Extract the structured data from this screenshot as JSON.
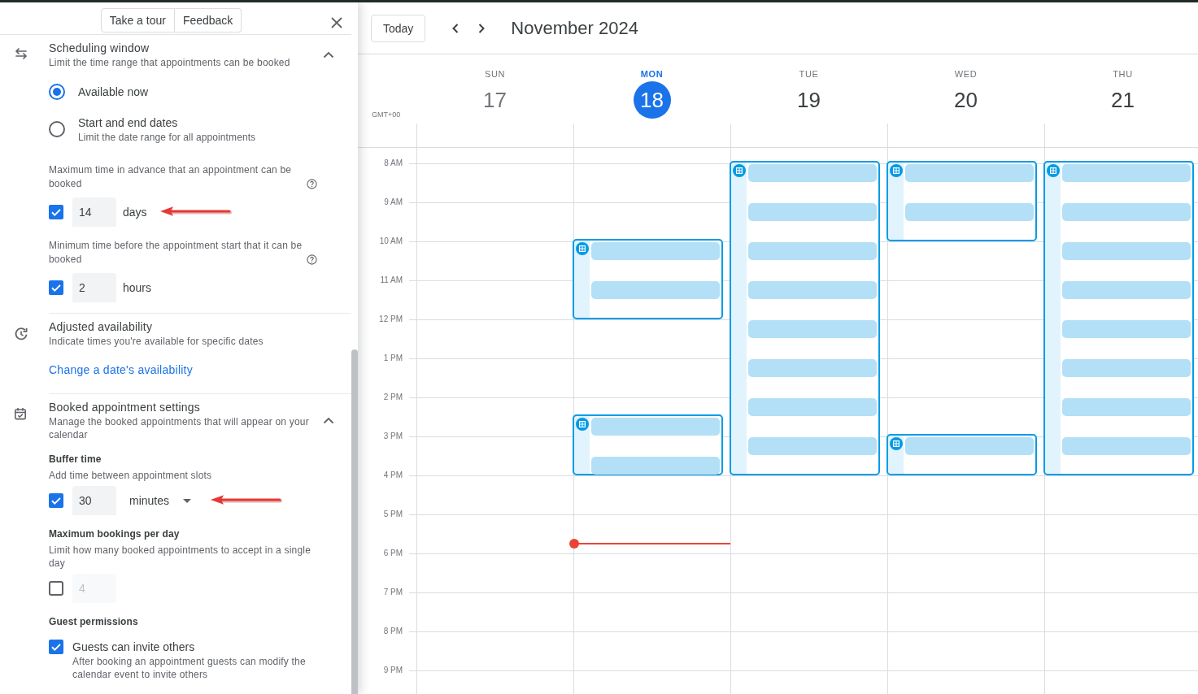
{
  "side_panel": {
    "header_buttons": [
      "Take a tour",
      "Feedback"
    ],
    "sections": [
      {
        "kind": "scheduling_window",
        "title": "Scheduling window",
        "subtitle": "Limit the time range that appointments can be booked",
        "expanded": true,
        "items": [
          {
            "kind": "radio",
            "label": "Available now",
            "selected": true
          },
          {
            "kind": "radio",
            "label": "Start and end dates",
            "description": "Limit the date range for all appointments",
            "selected": false
          },
          {
            "kind": "number",
            "label": "Maximum time in advance that an appointment can be booked",
            "help": true,
            "checked": true,
            "value": "14",
            "unit": "days",
            "unit_dropdown": false,
            "annotation_arrow": true
          },
          {
            "kind": "number",
            "label": "Minimum time before the appointment start that it can be booked",
            "help": true,
            "checked": true,
            "value": "2",
            "unit": "hours",
            "unit_dropdown": false,
            "annotation_arrow": false
          }
        ]
      },
      {
        "kind": "adjusted_availability",
        "title": "Adjusted availability",
        "subtitle": "Indicate times you're available for specific dates",
        "items": [
          {
            "kind": "link",
            "label": "Change a date's availability"
          }
        ]
      },
      {
        "kind": "booked_settings",
        "title": "Booked appointment settings",
        "subtitle": "Manage the booked appointments that will appear on your calendar",
        "expanded": true,
        "items": [
          {
            "kind": "number",
            "label": "Buffer time",
            "description": "Add time between appointment slots",
            "help": false,
            "checked": true,
            "value": "30",
            "unit": "minutes",
            "unit_dropdown": true,
            "annotation_arrow": true
          },
          {
            "kind": "number",
            "label": "Maximum bookings per day",
            "description": "Limit how many booked appointments to accept in a single day",
            "help": false,
            "checked": false,
            "value": "4",
            "annotation_arrow": false
          },
          {
            "kind": "checkbox",
            "label": "Guest permissions",
            "option": "Guests can invite others",
            "description": "After booking an appointment guests can modify the calendar event to invite others",
            "checked": true
          }
        ]
      }
    ]
  },
  "calendar": {
    "today_button": "Today",
    "title": "November 2024",
    "timezone": "GMT+00",
    "days": [
      {
        "name": "SUN",
        "date": "17",
        "today": false,
        "past": true
      },
      {
        "name": "MON",
        "date": "18",
        "today": true,
        "past": false,
        "half_hours": [
          {
            "kind": "free"
          },
          {
            "kind": "free"
          },
          {
            "kind": "free"
          },
          {
            "kind": "free"
          },
          {
            "kind": "slot"
          },
          {
            "kind": "buffer"
          },
          {
            "kind": "slot"
          },
          {
            "kind": "buffer"
          },
          {
            "kind": "free"
          },
          {
            "kind": "free"
          },
          {
            "kind": "free"
          },
          {
            "kind": "free"
          },
          {
            "kind": "free"
          },
          {
            "kind": "slot"
          },
          {
            "kind": "buffer"
          },
          {
            "kind": "slot"
          },
          {
            "kind": "free"
          },
          {
            "kind": "free"
          },
          {
            "kind": "free"
          },
          {
            "kind": "now"
          }
        ]
      },
      {
        "name": "TUE",
        "date": "19",
        "today": false,
        "past": false,
        "half_hours": [
          {
            "kind": "slot"
          },
          {
            "kind": "buffer"
          },
          {
            "kind": "slot"
          },
          {
            "kind": "buffer"
          },
          {
            "kind": "slot"
          },
          {
            "kind": "buffer"
          },
          {
            "kind": "slot"
          },
          {
            "kind": "buffer"
          },
          {
            "kind": "slot"
          },
          {
            "kind": "buffer"
          },
          {
            "kind": "slot"
          },
          {
            "kind": "buffer"
          },
          {
            "kind": "slot"
          },
          {
            "kind": "buffer"
          },
          {
            "kind": "slot"
          },
          {
            "kind": "buffer"
          }
        ]
      },
      {
        "name": "WED",
        "date": "20",
        "today": false,
        "past": false,
        "half_hours": [
          {
            "kind": "slot"
          },
          {
            "kind": "buffer"
          },
          {
            "kind": "slot"
          },
          {
            "kind": "buffer"
          },
          {
            "kind": "free"
          },
          {
            "kind": "free"
          },
          {
            "kind": "free"
          },
          {
            "kind": "free"
          },
          {
            "kind": "free"
          },
          {
            "kind": "free"
          },
          {
            "kind": "free"
          },
          {
            "kind": "free"
          },
          {
            "kind": "free"
          },
          {
            "kind": "free"
          },
          {
            "kind": "slot"
          },
          {
            "kind": "buffer"
          }
        ]
      },
      {
        "name": "THU",
        "date": "21",
        "today": false,
        "past": false,
        "half_hours": [
          {
            "kind": "slot"
          },
          {
            "kind": "buffer"
          },
          {
            "kind": "slot"
          },
          {
            "kind": "buffer"
          },
          {
            "kind": "slot"
          },
          {
            "kind": "buffer"
          },
          {
            "kind": "slot"
          },
          {
            "kind": "buffer"
          },
          {
            "kind": "slot"
          },
          {
            "kind": "buffer"
          },
          {
            "kind": "slot"
          },
          {
            "kind": "buffer"
          },
          {
            "kind": "slot"
          },
          {
            "kind": "buffer"
          },
          {
            "kind": "slot"
          },
          {
            "kind": "buffer"
          }
        ]
      }
    ],
    "hours": [
      "8 AM",
      "9 AM",
      "10 AM",
      "11 AM",
      "12 PM",
      "1 PM",
      "2 PM",
      "3 PM",
      "4 PM",
      "5 PM",
      "6 PM",
      "7 PM",
      "8 PM",
      "9 PM"
    ]
  }
}
